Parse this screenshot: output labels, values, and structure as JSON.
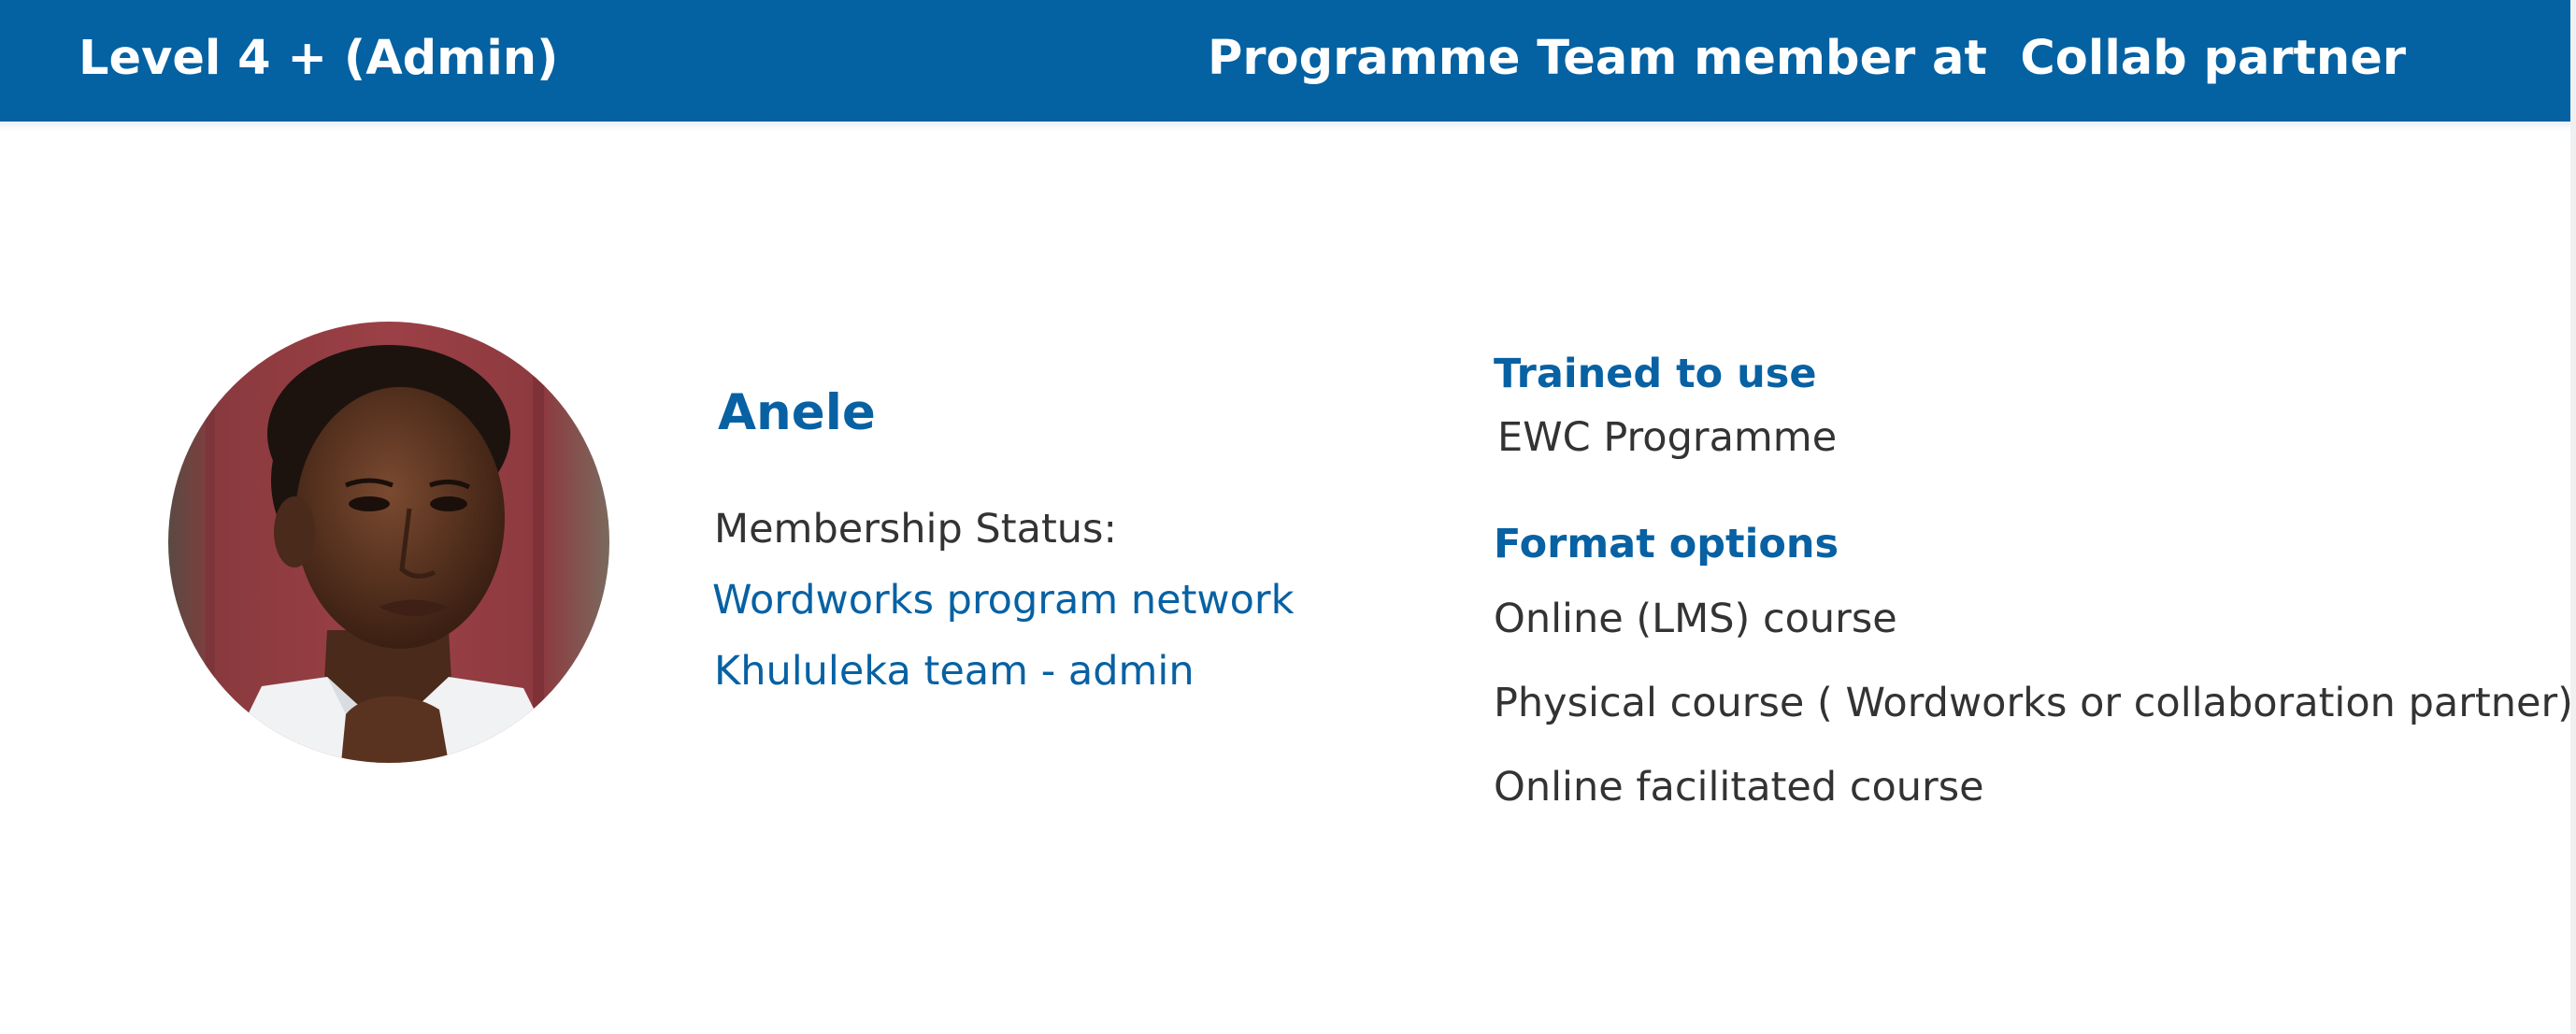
{
  "header": {
    "level_title": "Level 4 + (Admin)",
    "role_title": "Programme Team member at  Collab partner"
  },
  "profile": {
    "photo": "profile-photo",
    "name": "Anele",
    "membership_status_label": "Membership Status:",
    "memberships": [
      "Wordworks program network",
      "Khululeka team - admin"
    ]
  },
  "training": {
    "heading": "Trained to use",
    "value": "EWC Programme"
  },
  "format": {
    "heading": "Format options",
    "options": [
      "Online (LMS) course",
      "Physical course ( Wordworks or collaboration partner)",
      "Online facilitated course"
    ]
  },
  "colors": {
    "header_bg": "#0461a2",
    "accent_text": "#0761a3",
    "body_text": "#333333",
    "header_text": "#ffffff"
  }
}
